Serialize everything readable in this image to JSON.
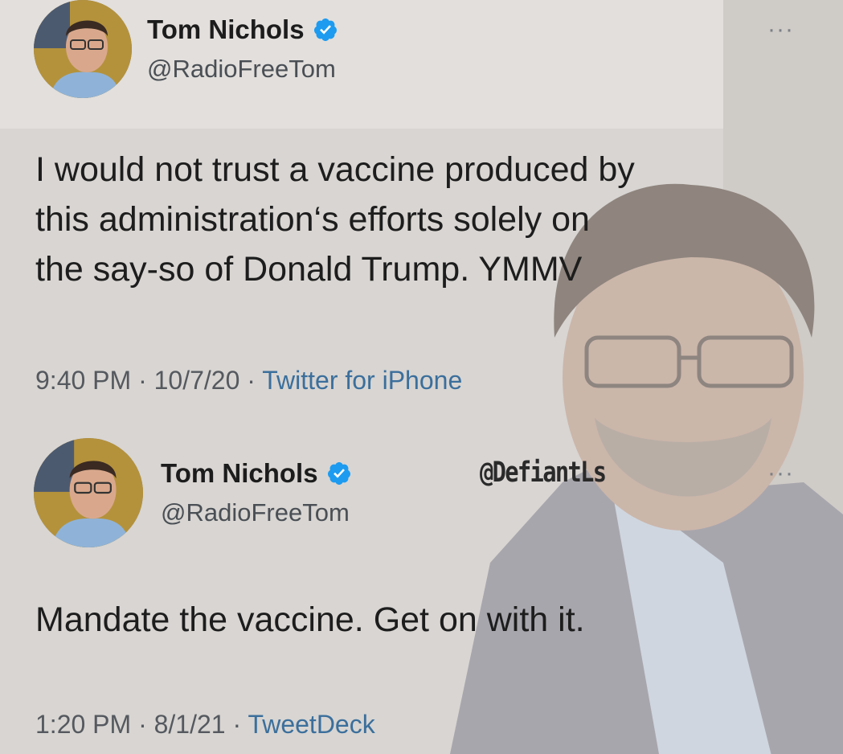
{
  "tweets": [
    {
      "author": "Tom Nichols",
      "handle": "@RadioFreeTom",
      "text": "I would not trust a vaccine produced by\nthis administration‘s efforts solely on\nthe say-so of Donald Trump. YMMV",
      "time": "9:40 PM",
      "date": "10/7/20",
      "source": "Twitter for iPhone",
      "sep": " · "
    },
    {
      "author": "Tom Nichols",
      "handle": "@RadioFreeTom",
      "text": "Mandate the vaccine. Get on with it.",
      "time": "1:20 PM",
      "date": "8/1/21",
      "source": "TweetDeck",
      "sep": " · "
    }
  ],
  "watermark": "@DefiantLs",
  "more_glyph": "···",
  "colors": {
    "verified": "#1d9bf0",
    "source_link": "#3b6f9c"
  },
  "icons": [
    "verified-badge-icon",
    "more-options-icon",
    "avatar"
  ]
}
